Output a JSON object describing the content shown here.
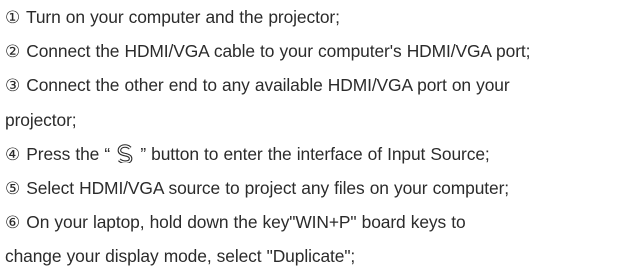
{
  "steps": [
    {
      "num": "①",
      "text": " Turn on your computer and the projector;"
    },
    {
      "num": "②",
      "text": " Connect the HDMI/VGA cable to your computer's HDMI/VGA port;"
    },
    {
      "num": "③",
      "text_line1": " Connect the other end to any available HDMI/VGA port on your",
      "text_line2": "projector;"
    },
    {
      "num": "④",
      "text_before": " Press the “ ",
      "icon": "source-input-icon",
      "text_after": " ” button to enter the interface of Input Source;"
    },
    {
      "num": "⑤",
      "text": " Select HDMI/VGA source to project any files on your computer;"
    },
    {
      "num": "⑥",
      "text_line1": " On your laptop, hold down the key\"WIN+P\" board keys to",
      "text_line2": "change your display mode, select \"Duplicate\";"
    }
  ]
}
